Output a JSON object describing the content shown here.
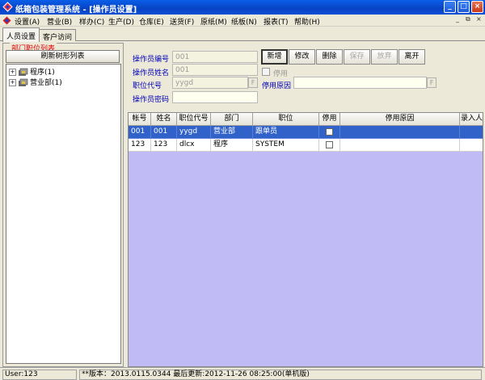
{
  "window": {
    "title": "纸箱包装管理系统 - [操作员设置]",
    "minimize": "_",
    "maximize": "□",
    "close": "×"
  },
  "menu": {
    "items": [
      "设置(A)",
      "营业(B)",
      "样办(C)",
      "生产(D)",
      "仓库(E)",
      "送货(F)",
      "原纸(M)",
      "纸板(N)",
      "报表(T)",
      "帮助(H)"
    ],
    "doc_controls": [
      "_",
      "⧉",
      "×"
    ]
  },
  "tabs": [
    "人员设置",
    "客户访问"
  ],
  "left_panel": {
    "legend": "部门职位列表",
    "refresh_button": "刷新树形列表",
    "tree": [
      "程序(1)",
      "营业部(1)"
    ]
  },
  "form": {
    "operator_id_label": "操作员编号",
    "operator_id_value": "001",
    "operator_name_label": "操作员姓名",
    "operator_name_value": "001",
    "position_code_label": "职位代号",
    "position_code_value": "yygd",
    "password_label": "操作员密码",
    "password_value": "",
    "disable_label": "停用",
    "disable_reason_label": "停用原因",
    "disable_reason_value": "",
    "picker_glyph": "F"
  },
  "buttons": {
    "add": "新增",
    "edit": "修改",
    "delete": "删除",
    "save": "保存",
    "abandon": "放弃",
    "leave": "离开"
  },
  "grid": {
    "columns": [
      "帐号",
      "姓名",
      "职位代号",
      "部门",
      "职位",
      "停用",
      "停用原因",
      "录入人"
    ],
    "rows": [
      {
        "account": "001",
        "name": "001",
        "code": "yygd",
        "dept": "营业部",
        "position": "跟单员",
        "disabled": false,
        "reason": ""
      },
      {
        "account": "123",
        "name": "123",
        "code": "dlcx",
        "dept": "程序",
        "position": "SYSTEM",
        "disabled": false,
        "reason": ""
      }
    ]
  },
  "status": {
    "user": "User:123",
    "version": "**版本：2013.0115.0344  最后更新:2012-11-26 08:25:00(单机版)"
  },
  "colors": {
    "titlebar": "#0a4fd6",
    "selected_row": "#3162c9",
    "grid_background": "#c0bbf5",
    "label_blue": "#0000b8",
    "legend_red": "#e00000"
  }
}
